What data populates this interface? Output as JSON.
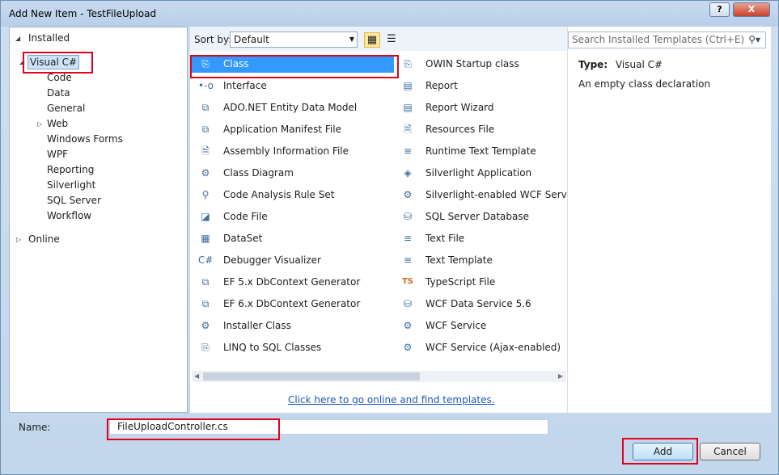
{
  "window": {
    "title": "Add New Item - TestFileUpload",
    "help": "?",
    "close": "X"
  },
  "tree": {
    "installed": "Installed",
    "visual_csharp": "Visual C#",
    "children": [
      "Code",
      "Data",
      "General",
      "Web",
      "Windows Forms",
      "WPF",
      "Reporting",
      "Silverlight",
      "SQL Server",
      "Workflow"
    ],
    "online": "Online"
  },
  "sort": {
    "label": "Sort by:",
    "value": "Default"
  },
  "templates": {
    "column1": [
      {
        "label": "Class",
        "icon": "class-icon",
        "glyph": "⎘"
      },
      {
        "label": "Interface",
        "icon": "interface-icon",
        "glyph": "•-o"
      },
      {
        "label": "ADO.NET Entity Data Model",
        "icon": "entity-model-icon",
        "glyph": "⧉"
      },
      {
        "label": "Application Manifest File",
        "icon": "manifest-icon",
        "glyph": "⧉"
      },
      {
        "label": "Assembly Information File",
        "icon": "assembly-info-icon",
        "glyph": "🗎"
      },
      {
        "label": "Class Diagram",
        "icon": "class-diagram-icon",
        "glyph": "⚙"
      },
      {
        "label": "Code Analysis Rule Set",
        "icon": "rule-set-icon",
        "glyph": "⚲"
      },
      {
        "label": "Code File",
        "icon": "code-file-icon",
        "glyph": "◪"
      },
      {
        "label": "DataSet",
        "icon": "dataset-icon",
        "glyph": "▦"
      },
      {
        "label": "Debugger Visualizer",
        "icon": "debugger-visualizer-icon",
        "glyph": "C#"
      },
      {
        "label": "EF 5.x DbContext Generator",
        "icon": "ef5-generator-icon",
        "glyph": "⧉"
      },
      {
        "label": "EF 6.x DbContext Generator",
        "icon": "ef6-generator-icon",
        "glyph": "⧉"
      },
      {
        "label": "Installer Class",
        "icon": "installer-icon",
        "glyph": "⚙"
      },
      {
        "label": "LINQ to SQL Classes",
        "icon": "linq-icon",
        "glyph": "⎘"
      }
    ],
    "column2": [
      {
        "label": "OWIN Startup class",
        "icon": "owin-icon",
        "glyph": "⎘"
      },
      {
        "label": "Report",
        "icon": "report-icon",
        "glyph": "▤"
      },
      {
        "label": "Report Wizard",
        "icon": "report-wizard-icon",
        "glyph": "▤"
      },
      {
        "label": "Resources File",
        "icon": "resources-icon",
        "glyph": "🗎"
      },
      {
        "label": "Runtime Text Template",
        "icon": "runtime-template-icon",
        "glyph": "≡"
      },
      {
        "label": "Silverlight Application",
        "icon": "silverlight-icon",
        "glyph": "◈"
      },
      {
        "label": "Silverlight-enabled WCF Service",
        "icon": "silverlight-wcf-icon",
        "glyph": "⚙"
      },
      {
        "label": "SQL Server Database",
        "icon": "database-icon",
        "glyph": "⛁"
      },
      {
        "label": "Text File",
        "icon": "text-file-icon",
        "glyph": "≡"
      },
      {
        "label": "Text Template",
        "icon": "text-template-icon",
        "glyph": "≡"
      },
      {
        "label": "TypeScript File",
        "icon": "typescript-icon",
        "glyph": "TS"
      },
      {
        "label": "WCF Data Service 5.6",
        "icon": "wcf-data-service-icon",
        "glyph": "⛁"
      },
      {
        "label": "WCF Service",
        "icon": "wcf-service-icon",
        "glyph": "⚙"
      },
      {
        "label": "WCF Service (Ajax-enabled)",
        "icon": "wcf-ajax-icon",
        "glyph": "⚙"
      }
    ]
  },
  "online_link": "Click here to go online and find templates.",
  "search": {
    "placeholder": "Search Installed Templates (Ctrl+E)"
  },
  "details": {
    "type_label": "Type:",
    "type_value": "Visual C#",
    "description": "An empty class declaration"
  },
  "name": {
    "label": "Name:",
    "value": "FileUploadController.cs"
  },
  "buttons": {
    "add": "Add",
    "cancel": "Cancel"
  },
  "colors": {
    "selection": "#3399ff",
    "highlight": "#e0001b",
    "link": "#1b57b8"
  }
}
